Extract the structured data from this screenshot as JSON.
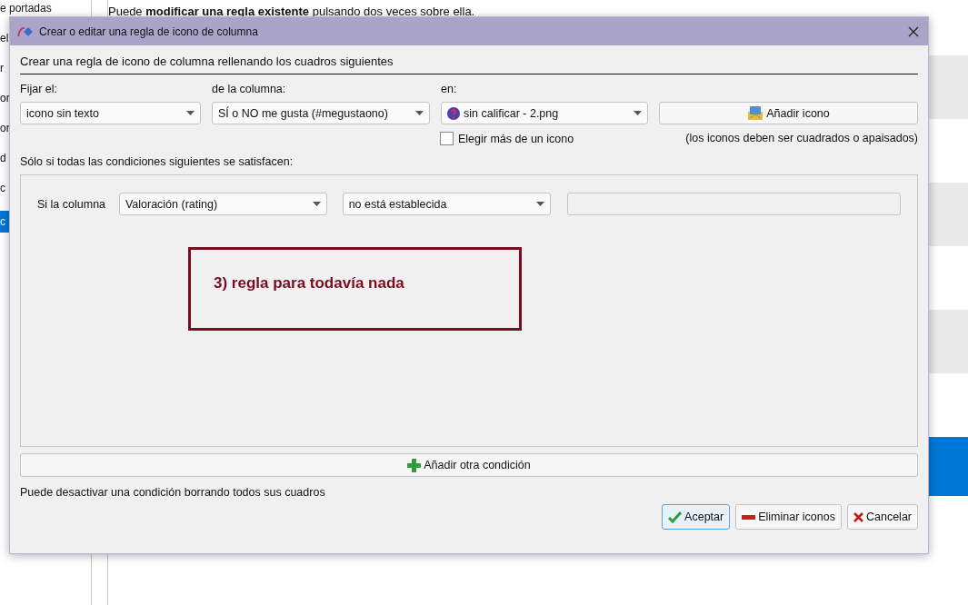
{
  "background": {
    "sidebar_items": [
      {
        "label": "e portadas",
        "selected": false
      },
      {
        "label": "el",
        "selected": false
      },
      {
        "label": "r",
        "selected": false
      },
      {
        "label": "or",
        "selected": false
      },
      {
        "label": "or",
        "selected": false
      },
      {
        "label": "d",
        "selected": false
      },
      {
        "label": "c",
        "selected": false
      },
      {
        "label": "c",
        "selected": true
      }
    ],
    "instruction": "Puede **modificar una regla existente** pulsando dos veces sobre ella.",
    "rows": [
      {
        "selected": false
      },
      {
        "selected": false
      },
      {
        "selected": false
      },
      {
        "selected": false
      },
      {
        "selected": false
      },
      {
        "selected": false
      },
      {
        "selected": true
      }
    ]
  },
  "dialog": {
    "title": "Crear o editar una regla de icono de columna",
    "heading": "Crear una regla de icono de columna rellenando los cuadros siguientes",
    "fields": [
      {
        "label": "Fijar el:",
        "value": "icono sin texto",
        "kind": "plain"
      },
      {
        "label": "de la columna:",
        "value": "SÍ o NO me gusta (#megustaono)",
        "kind": "plain"
      },
      {
        "label": "en:",
        "value": "sin calificar - 2.png",
        "kind": "icon"
      }
    ],
    "add_icon_button": "Añadir icono",
    "multiple_icons": {
      "label": "Elegir más de un icono",
      "checked": false
    },
    "icon_note": "(los iconos deben ser cuadrados o apaisados)",
    "conditions_label": "Sólo si todas las condiciones siguientes se satisfacen:",
    "conditions": [
      {
        "label": "Si la columna",
        "column": "Valoración (rating)",
        "operator": "no está establecida"
      }
    ],
    "annotation": "3) regla para todavía nada",
    "add_condition_button": "Añadir otra condición",
    "footer_note": "Puede desactivar una condición borrando todos sus cuadros",
    "buttons": [
      {
        "label": "Aceptar",
        "kind": "accept",
        "default": true
      },
      {
        "label": "Eliminar iconos",
        "kind": "remove",
        "default": false
      },
      {
        "label": "Cancelar",
        "kind": "cancel",
        "default": false
      }
    ]
  }
}
